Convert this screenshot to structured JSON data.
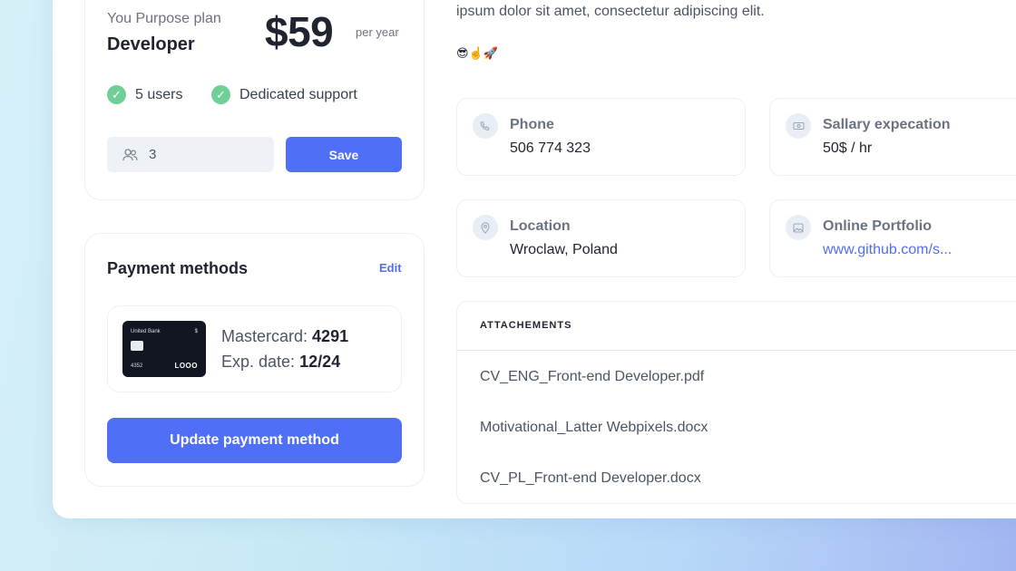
{
  "plan": {
    "label": "You Purpose plan",
    "name": "Developer",
    "price": "$59",
    "period": "per year",
    "features": [
      "5 users",
      "Dedicated support"
    ],
    "seats_value": "3",
    "save_label": "Save"
  },
  "payment": {
    "title": "Payment methods",
    "edit_label": "Edit",
    "card": {
      "bank_name": "United Bank",
      "symbol": "$",
      "short_number": "4352",
      "logo": "LOOO"
    },
    "method_label": "Mastercard:",
    "method_number": "4291",
    "exp_label": "Exp. date:",
    "exp_value": "12/24",
    "update_label": "Update payment method"
  },
  "profile": {
    "bio": "ipsum dolor sit amet, consectetur adipiscing elit.",
    "emojis": "😎☝️🚀",
    "phone": {
      "label": "Phone",
      "value": "506 774 323"
    },
    "salary": {
      "label": "Sallary expecation",
      "value": "50$ / hr"
    },
    "location": {
      "label": "Location",
      "value": "Wroclaw, Poland"
    },
    "portfolio": {
      "label": "Online Portfolio",
      "value": "www.github.com/s..."
    }
  },
  "attachments": {
    "heading": "ATTACHEMENTS",
    "files": [
      "CV_ENG_Front-end Developer.pdf",
      "Motivational_Latter Webpixels.docx",
      "CV_PL_Front-end Developer.docx"
    ]
  },
  "colors": {
    "accent": "#4f6ff7",
    "success": "#6fcf97",
    "card_dark": "#111622"
  }
}
